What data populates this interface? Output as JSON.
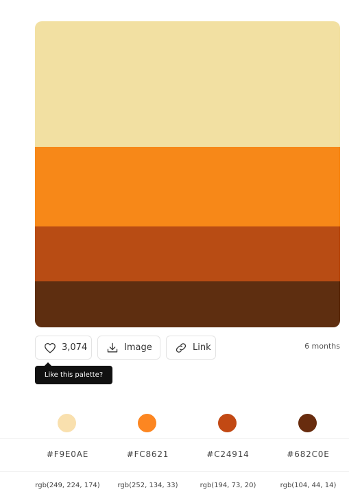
{
  "palette": {
    "colors": [
      {
        "hex": "#F9E0AE",
        "rgb": "rgb(249, 224, 174)",
        "swatch_color": "#F2E0A2"
      },
      {
        "hex": "#FC8621",
        "rgb": "rgb(252, 134, 33)",
        "swatch_color": "#F78818"
      },
      {
        "hex": "#C24914",
        "rgb": "rgb(194, 73, 20)",
        "swatch_color": "#B84C14"
      },
      {
        "hex": "#682C0E",
        "rgb": "rgb(104, 44, 14)",
        "swatch_color": "#5E2E10"
      }
    ]
  },
  "actions": {
    "like_count": "3,074",
    "image_label": "Image",
    "link_label": "Link"
  },
  "meta": {
    "age": "6 months"
  },
  "tooltip": {
    "text": "Like this palette?"
  },
  "icons": {
    "like": "heart-icon",
    "image": "download-icon",
    "link": "link-icon"
  }
}
